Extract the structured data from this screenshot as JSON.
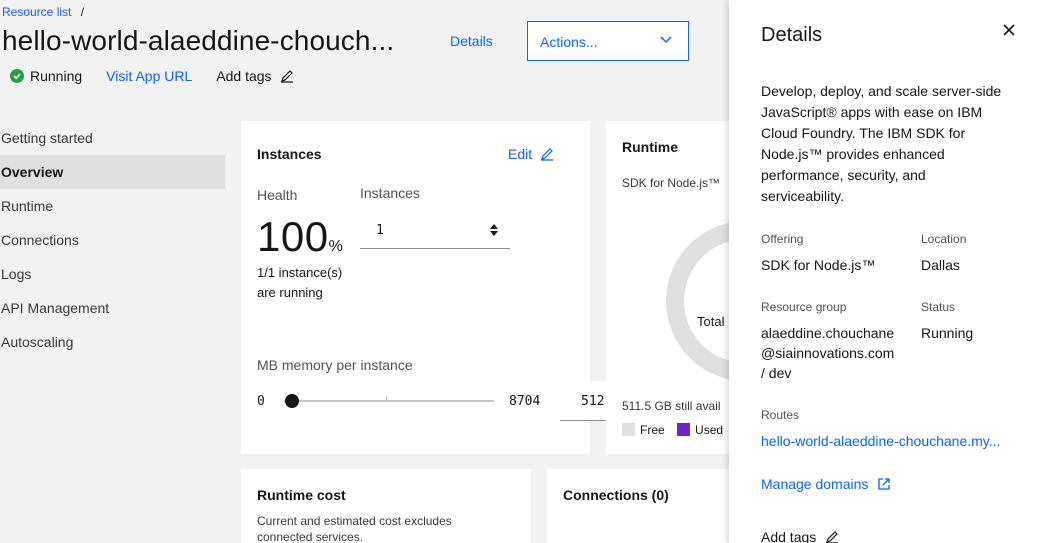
{
  "breadcrumb": {
    "resource_list": "Resource list",
    "sep": "/"
  },
  "app": {
    "title": "hello-world-alaeddine-chouch...",
    "status": "Running",
    "visit_url": "Visit App URL",
    "add_tags": "Add tags"
  },
  "header": {
    "details_label": "Details",
    "actions_label": "Actions..."
  },
  "nav": {
    "items": [
      "Getting started",
      "Overview",
      "Runtime",
      "Connections",
      "Logs",
      "API Management",
      "Autoscaling"
    ],
    "active": "Overview"
  },
  "instances": {
    "title": "Instances",
    "edit": "Edit",
    "health_label": "Health",
    "health_value": "100",
    "health_unit": "%",
    "instances_label": "Instances",
    "instances_value": "1",
    "running_line1": "1/1 instance(s)",
    "running_line2": "are running",
    "memory_label": "MB memory per instance",
    "mem_min": "0",
    "mem_max": "8704",
    "mem_value": "512",
    "mem_fraction": 0.059
  },
  "runtime": {
    "title": "Runtime",
    "subtitle": "SDK for Node.js™",
    "donut_center": "Total",
    "still_available": "511.5 GB still avail",
    "legend_free": "Free",
    "legend_used": "Used",
    "colors": {
      "free": "#e0e0e0",
      "used": "#6929c4"
    }
  },
  "cost": {
    "title": "Runtime cost",
    "desc_line1": "Current and estimated cost excludes",
    "desc_line2": "connected services."
  },
  "connections": {
    "title": "Connections (0)"
  },
  "panel": {
    "title": "Details",
    "desc": [
      "Develop, deploy, and scale server-side",
      "JavaScript® apps with ease on IBM",
      "Cloud Foundry. The IBM SDK for",
      "Node.js™ provides enhanced",
      "performance, security, and",
      "serviceability."
    ],
    "offering_label": "Offering",
    "offering_value": "SDK for Node.js™",
    "location_label": "Location",
    "location_value": "Dallas",
    "resource_group_label": "Resource group",
    "resource_group_lines": [
      "alaeddine.chouchane",
      "@siainnovations.com",
      "/ dev"
    ],
    "status_label": "Status",
    "status_value": "Running",
    "routes_label": "Routes",
    "route_value": "hello-world-alaeddine-chouchane.my...",
    "manage_domains": "Manage domains",
    "add_tags": "Add tags"
  },
  "colors": {
    "accent": "#0f62fe",
    "success": "#24a148"
  },
  "icons": [
    "checkmark-filled-icon",
    "edit-icon",
    "chevron-down-icon",
    "caret-sort-icon",
    "close-icon",
    "launch-icon"
  ]
}
